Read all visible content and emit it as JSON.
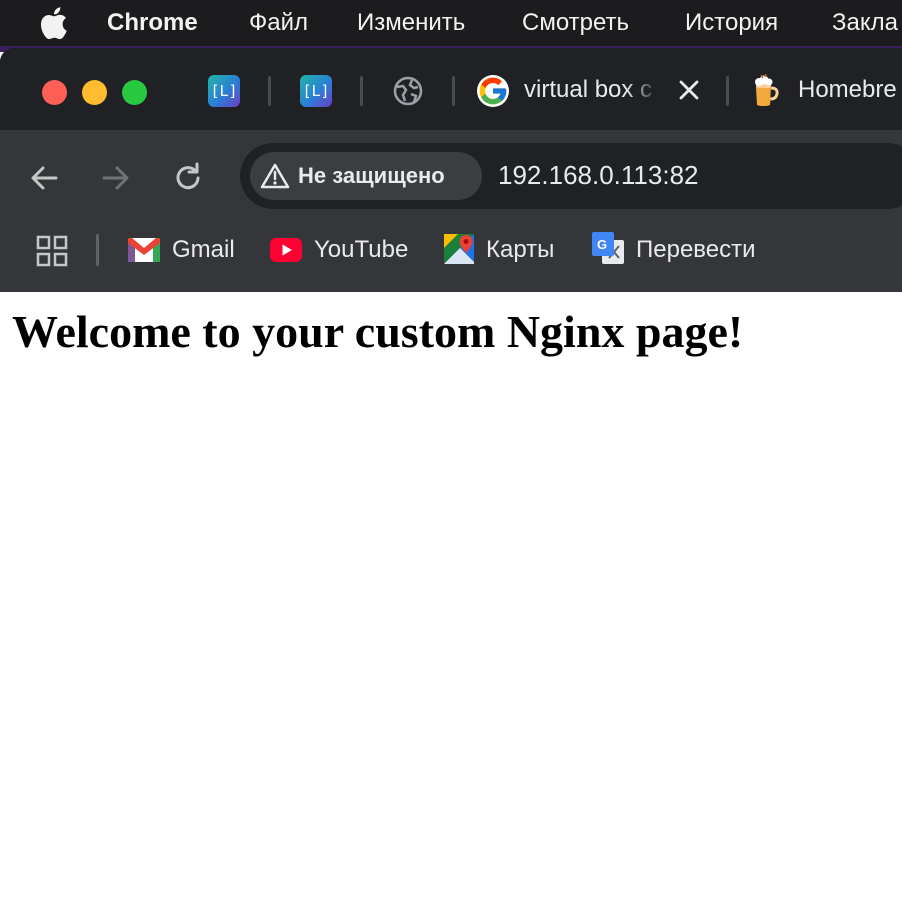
{
  "menubar": {
    "apple_icon": "apple-logo-icon",
    "app_name": "Chrome",
    "items": [
      "Файл",
      "Изменить",
      "Смотреть",
      "История",
      "Закла"
    ]
  },
  "window_controls": {
    "close_color": "#fe5f57",
    "minimize_color": "#febc2e",
    "maximize_color": "#28c840"
  },
  "tabs": [
    {
      "icon": "l-app-icon",
      "favicon_text": "[L]",
      "title": ""
    },
    {
      "icon": "l-app-icon",
      "favicon_text": "[L]",
      "title": ""
    },
    {
      "icon": "globe-icon",
      "title": ""
    },
    {
      "icon": "google-icon",
      "title": "virtual box c",
      "active": true
    },
    {
      "icon": "homebrew-beer-icon",
      "title": "Homebre"
    }
  ],
  "toolbar": {
    "back_icon": "back-arrow-icon",
    "forward_icon": "forward-arrow-icon",
    "reload_icon": "reload-icon",
    "security_label": "Не защищено",
    "security_icon": "warning-triangle-icon",
    "url": "192.168.0.113:82"
  },
  "bookmarks": {
    "apps_icon": "apps-grid-icon",
    "items": [
      {
        "icon": "gmail-icon",
        "label": "Gmail"
      },
      {
        "icon": "youtube-icon",
        "label": "YouTube"
      },
      {
        "icon": "google-maps-icon",
        "label": "Карты"
      },
      {
        "icon": "google-translate-icon",
        "label": "Перевести"
      }
    ]
  },
  "page": {
    "heading": "Welcome to your custom Nginx page!"
  },
  "colors": {
    "menubar_bg": "#1c1c1e",
    "tabstrip_bg": "#202124",
    "toolbar_bg": "#35363a",
    "page_bg": "#ffffff"
  }
}
